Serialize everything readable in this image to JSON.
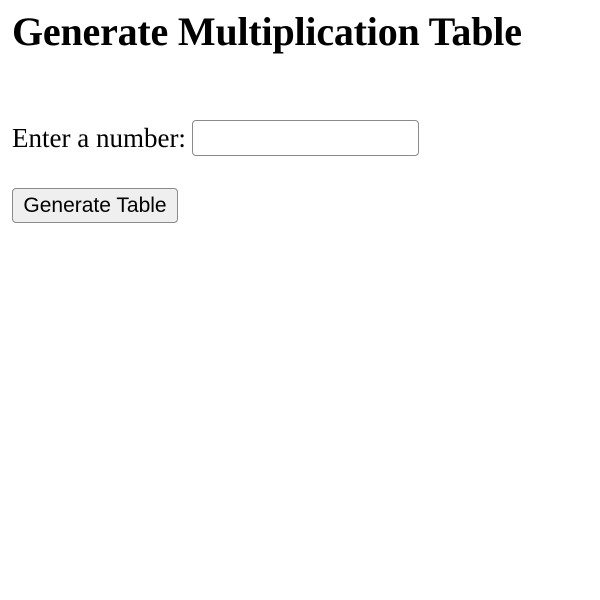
{
  "page": {
    "title": "Generate Multiplication Table"
  },
  "form": {
    "number_label": "Enter a number:",
    "number_value": "",
    "number_placeholder": "",
    "generate_button_label": "Generate Table"
  }
}
